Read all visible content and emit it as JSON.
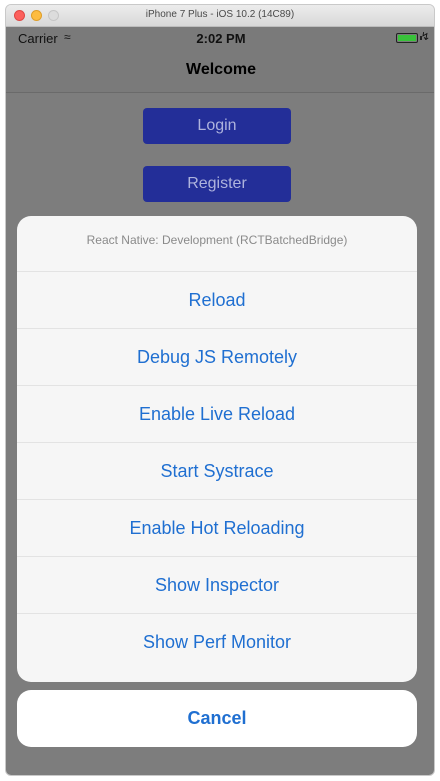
{
  "window": {
    "title": "iPhone 7 Plus - iOS 10.2 (14C89)"
  },
  "statusbar": {
    "carrier": "Carrier",
    "time": "2:02 PM",
    "battery_level": 1.0
  },
  "navbar": {
    "title": "Welcome"
  },
  "buttons": {
    "login": "Login",
    "register": "Register"
  },
  "action_sheet": {
    "title": "React Native: Development (RCTBatchedBridge)",
    "items": [
      "Reload",
      "Debug JS Remotely",
      "Enable Live Reload",
      "Start Systrace",
      "Enable Hot Reloading",
      "Show Inspector",
      "Show Perf Monitor"
    ],
    "cancel": "Cancel"
  },
  "colors": {
    "action_blue": "#1f6fd1",
    "primary_button": "#232e98",
    "battery_green": "#39c23a"
  }
}
